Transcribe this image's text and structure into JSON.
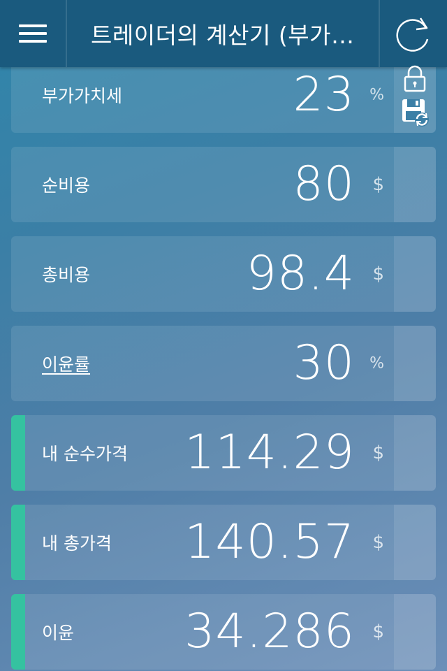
{
  "header": {
    "title": "트레이더의 계산기 (부가가…"
  },
  "rows": [
    {
      "label": "부가가치세",
      "value": "23",
      "unit": "%"
    },
    {
      "label": "순비용",
      "value": "80",
      "unit": "$"
    },
    {
      "label": "총비용",
      "value": "98.4",
      "unit": "$"
    },
    {
      "label": "이윤률",
      "value": "30",
      "unit": "%"
    },
    {
      "label": "내 순수가격",
      "value": "114.29",
      "unit": "$"
    },
    {
      "label": "내 총가격",
      "value": "140.57",
      "unit": "$"
    },
    {
      "label": "이윤",
      "value": "34.286",
      "unit": "$"
    }
  ],
  "icons": {
    "menu": "hamburger-menu-icon",
    "refresh": "refresh-icon",
    "lock": "lock-icon",
    "save": "save-sync-icon"
  },
  "colors": {
    "appbar": "#1a5a7e",
    "accent": "#35c2a0"
  }
}
